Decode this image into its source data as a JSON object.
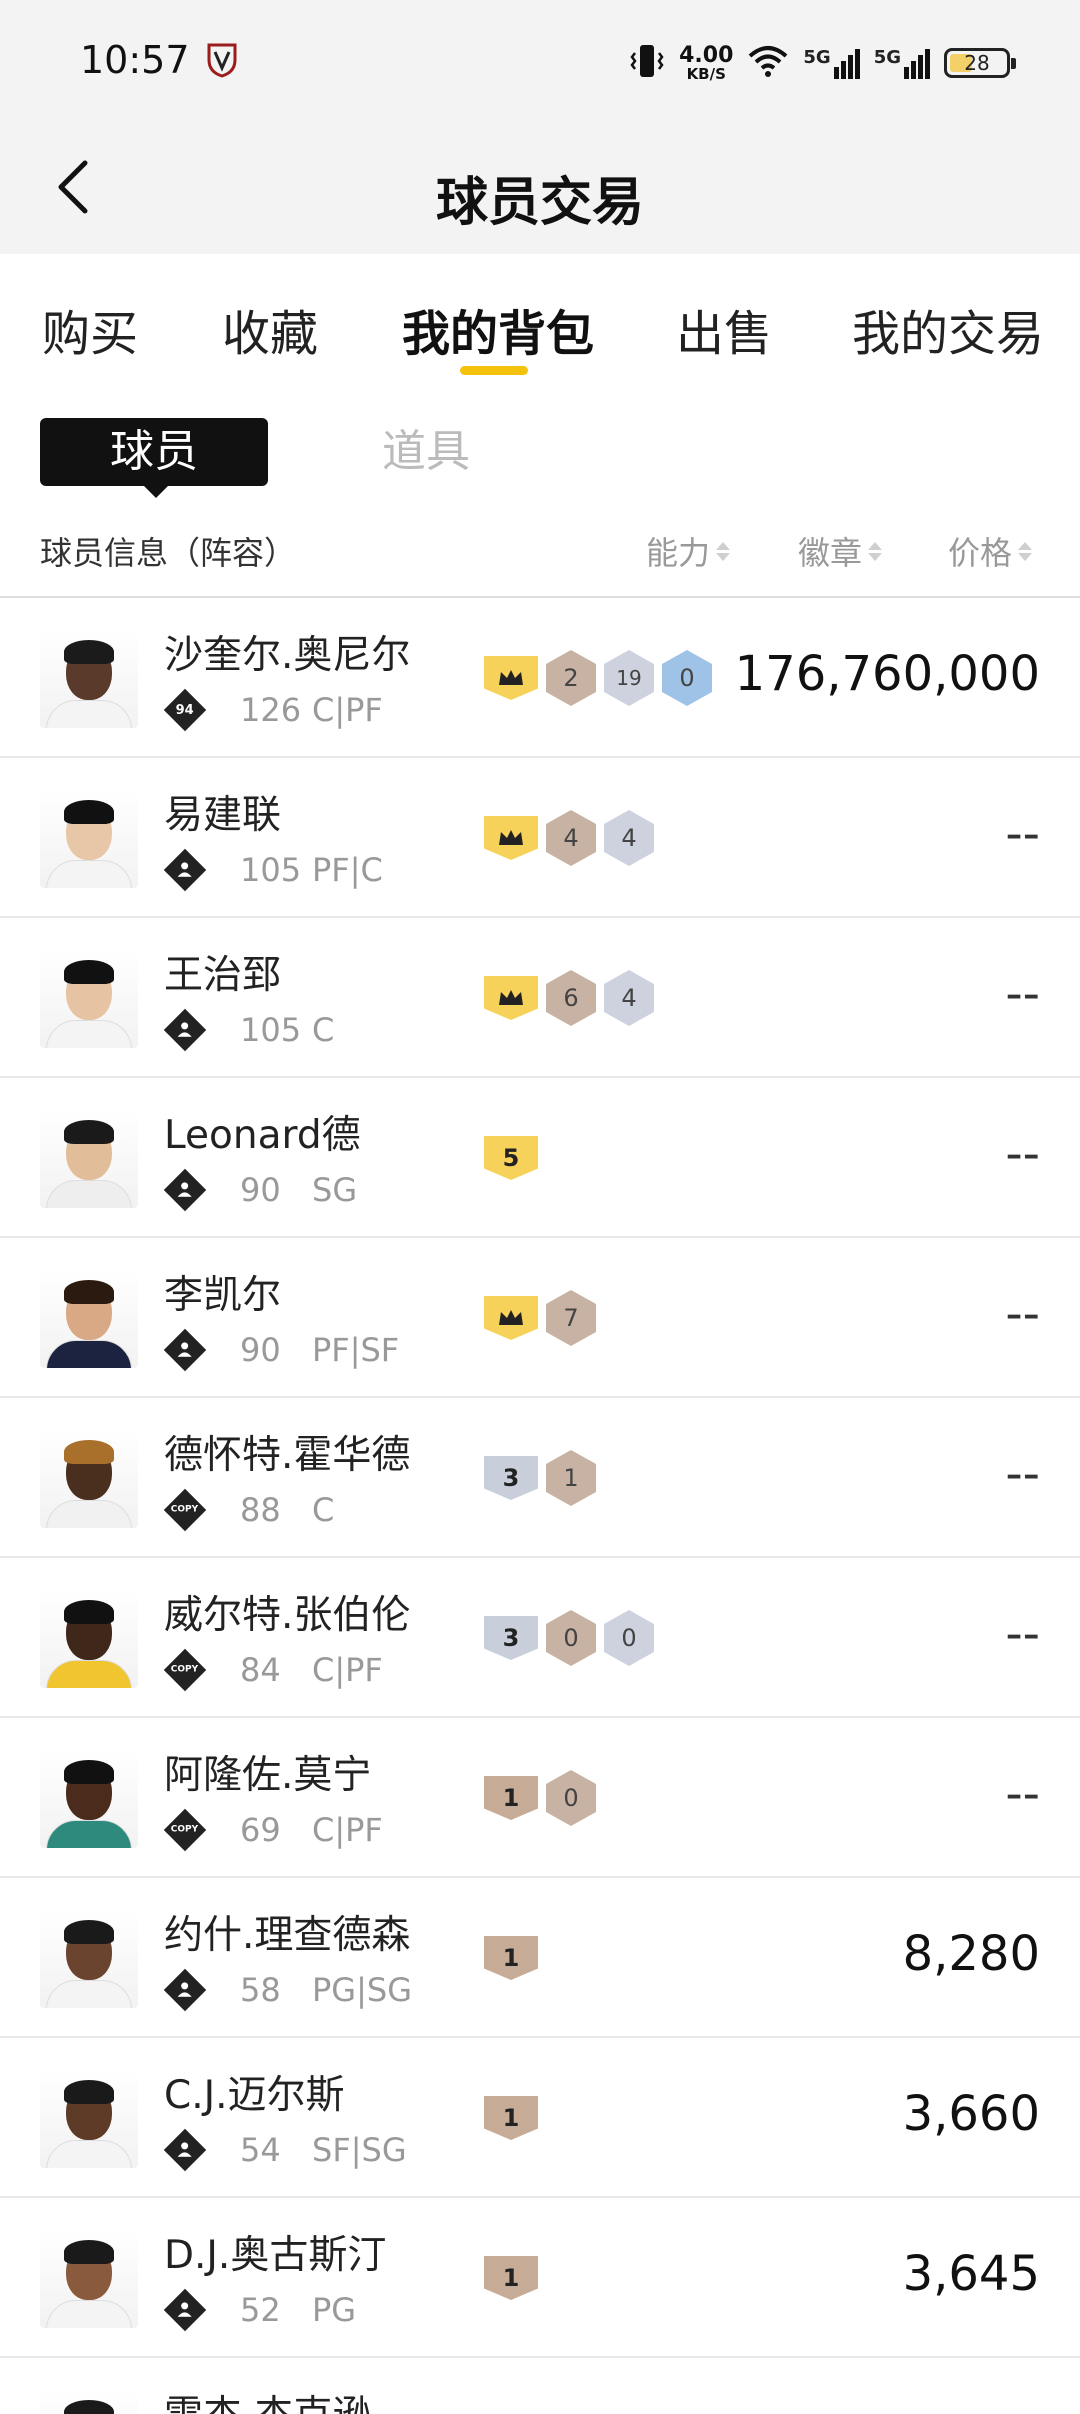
{
  "status_bar": {
    "time": "10:57",
    "app_icon": "team-logo-icon",
    "net_speed_value": "4.00",
    "net_speed_unit": "KB/S",
    "signal_1_label": "5G",
    "signal_2_label": "5G",
    "battery_level": "28"
  },
  "header": {
    "back_icon": "chevron-left-icon",
    "title": "球员交易"
  },
  "tabs": [
    {
      "label": "购买",
      "active": false
    },
    {
      "label": "收藏",
      "active": false
    },
    {
      "label": "我的背包",
      "active": true
    },
    {
      "label": "出售",
      "active": false
    },
    {
      "label": "我的交易",
      "active": false
    }
  ],
  "sub_tabs": [
    {
      "label": "球员",
      "active": true
    },
    {
      "label": "道具",
      "active": false
    }
  ],
  "columns": {
    "info": "球员信息（阵容）",
    "ability": "能力",
    "badge": "徽章",
    "price": "价格"
  },
  "colors": {
    "accent": "#f4c20d",
    "gold_badge": "#f6d25b",
    "silver_badge": "#c9cedb",
    "bronze_badge": "#c6ab97",
    "blue_badge": "#9fc3e6"
  },
  "players": [
    {
      "name": "沙奎尔.奥尼尔",
      "tier": "94",
      "rating": "126",
      "position": "C|PF",
      "badges": [
        {
          "shape": "shield",
          "color": "gold",
          "icon": "crown-icon"
        },
        {
          "shape": "hex",
          "color": "bronze",
          "value": "2"
        },
        {
          "shape": "hex",
          "color": "silver",
          "value": "19"
        },
        {
          "shape": "hex",
          "color": "blue",
          "value": "0"
        }
      ],
      "price": "176,760,000"
    },
    {
      "name": "易建联",
      "tier": "",
      "rating": "105",
      "position": "PF|C",
      "badges": [
        {
          "shape": "shield",
          "color": "gold",
          "icon": "crown-icon"
        },
        {
          "shape": "hex",
          "color": "bronze",
          "value": "4"
        },
        {
          "shape": "hex",
          "color": "silver",
          "value": "4"
        }
      ],
      "price": "--"
    },
    {
      "name": "王治郅",
      "tier": "",
      "rating": "105",
      "position": "C",
      "badges": [
        {
          "shape": "shield",
          "color": "gold",
          "icon": "crown-icon"
        },
        {
          "shape": "hex",
          "color": "bronze",
          "value": "6"
        },
        {
          "shape": "hex",
          "color": "silver",
          "value": "4"
        }
      ],
      "price": "--"
    },
    {
      "name": "Leonard德",
      "tier": "",
      "rating": "90",
      "position": "SG",
      "badges": [
        {
          "shape": "shield",
          "color": "gold",
          "value": "5"
        }
      ],
      "price": "--"
    },
    {
      "name": "李凯尔",
      "tier": "",
      "rating": "90",
      "position": "PF|SF",
      "badges": [
        {
          "shape": "shield",
          "color": "gold",
          "icon": "crown-icon"
        },
        {
          "shape": "hex",
          "color": "bronze",
          "value": "7"
        }
      ],
      "price": "--"
    },
    {
      "name": "德怀特.霍华德",
      "tier": "COPY",
      "rating": "88",
      "position": "C",
      "badges": [
        {
          "shape": "shield",
          "color": "silver",
          "value": "3"
        },
        {
          "shape": "hex",
          "color": "bronze",
          "value": "1"
        }
      ],
      "price": "--"
    },
    {
      "name": "威尔特.张伯伦",
      "tier": "COPY",
      "rating": "84",
      "position": "C|PF",
      "badges": [
        {
          "shape": "shield",
          "color": "silver",
          "value": "3"
        },
        {
          "shape": "hex",
          "color": "bronze",
          "value": "0"
        },
        {
          "shape": "hex",
          "color": "silver",
          "value": "0"
        }
      ],
      "price": "--"
    },
    {
      "name": "阿隆佐.莫宁",
      "tier": "COPY",
      "rating": "69",
      "position": "C|PF",
      "badges": [
        {
          "shape": "shield",
          "color": "bronze",
          "value": "1"
        },
        {
          "shape": "hex",
          "color": "bronze",
          "value": "0"
        }
      ],
      "price": "--"
    },
    {
      "name": "约什.理查德森",
      "tier": "",
      "rating": "58",
      "position": "PG|SG",
      "badges": [
        {
          "shape": "shield",
          "color": "bronze",
          "value": "1"
        }
      ],
      "price": "8,280"
    },
    {
      "name": "C.J.迈尔斯",
      "tier": "",
      "rating": "54",
      "position": "SF|SG",
      "badges": [
        {
          "shape": "shield",
          "color": "bronze",
          "value": "1"
        }
      ],
      "price": "3,660"
    },
    {
      "name": "D.J.奥古斯汀",
      "tier": "",
      "rating": "52",
      "position": "PG",
      "badges": [
        {
          "shape": "shield",
          "color": "bronze",
          "value": "1"
        }
      ],
      "price": "3,645"
    },
    {
      "name": "雷杰.杰克逊",
      "tier": "",
      "rating": "",
      "position": "",
      "badges": [],
      "price": ""
    }
  ]
}
